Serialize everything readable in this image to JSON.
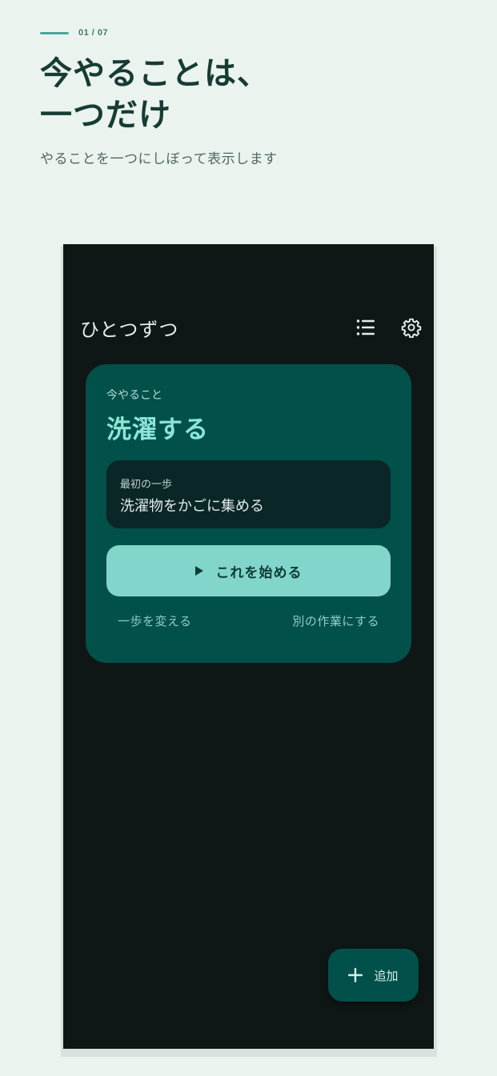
{
  "promo": {
    "counter": "01 / 07",
    "headline_line1": "今やることは、",
    "headline_line2": "一つだけ",
    "subhead": "やることを一つにしぼって表示します"
  },
  "app": {
    "title": "ひとつずつ",
    "icons": {
      "list": "list-icon",
      "settings": "gear-icon",
      "play": "play-icon",
      "add": "plus-icon"
    }
  },
  "card": {
    "label": "今やること",
    "task": "洗濯する",
    "step_label": "最初の一歩",
    "step_text": "洗濯物をかごに集める",
    "start_label": "これを始める",
    "change_step": "一歩を変える",
    "other_task": "別の作業にする"
  },
  "fab": {
    "label": "追加"
  },
  "colors": {
    "page_bg": "#ebf3ef",
    "accent_line": "#4aa898",
    "headline": "#163c33",
    "phone_bg": "#0f1716",
    "card_bg": "#02504a",
    "task_title": "#8ce6d8",
    "step_box": "#0b2627",
    "start_button": "#82d5cb"
  }
}
